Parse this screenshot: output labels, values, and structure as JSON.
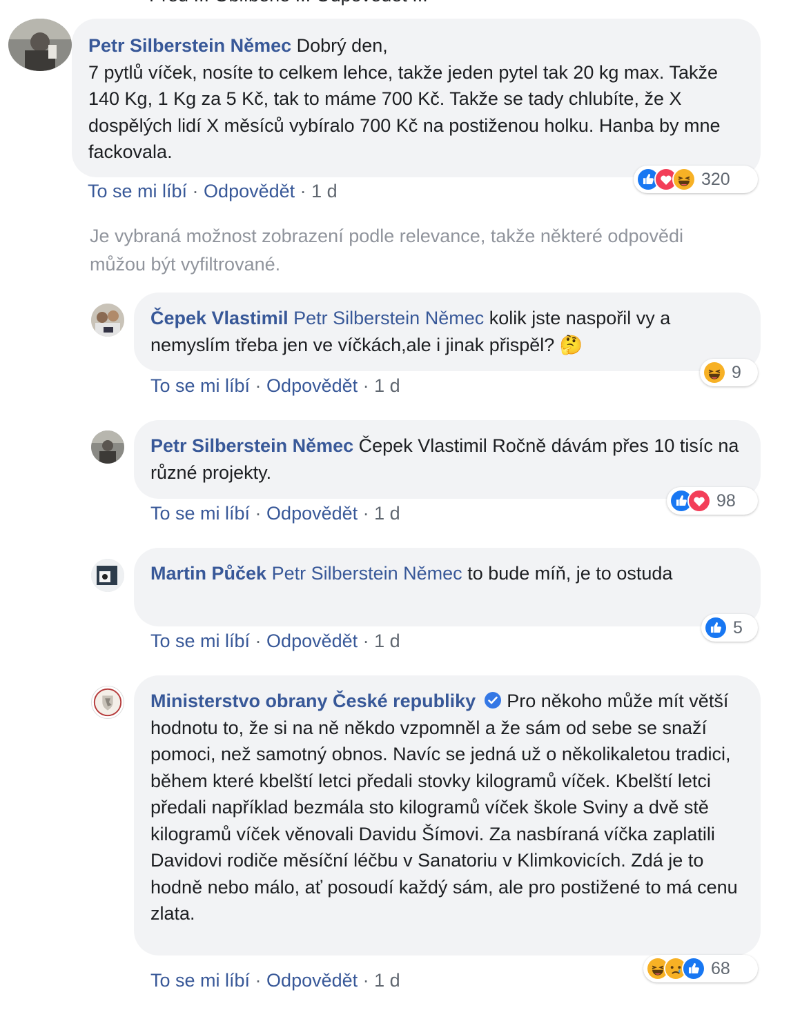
{
  "cut_off_text": "Před ... Oblíbené ... Odpovědět ...",
  "actions": {
    "like": "To se mi líbí",
    "reply": "Odpovědět",
    "sep": " · "
  },
  "notice": "Je vybraná možnost zobrazení podle relevance, takže některé odpovědi můžou být vyfiltrované.",
  "comments": [
    {
      "author": "Petr Silberstein Němec",
      "mention": "",
      "text": "Dobrý den,\n7 pytlů víček, nosíte to celkem lehce, takže jeden pytel tak 20 kg max. Takže 140 Kg, 1 Kg za 5 Kč, tak to máme 700 Kč. Takže se tady chlubíte, že X dospělých lidí X měsíců vybíralo 700 Kč na postiženou holku. Hanba by mne fackovala.",
      "time": "1 d",
      "reactions": [
        "like-icon",
        "love-icon",
        "haha-icon"
      ],
      "reaction_count": "320"
    },
    {
      "author": "Čepek Vlastimil",
      "mention": "Petr Silberstein Němec",
      "text": " kolik jste naspořil vy a nemyslím třeba jen ve víčkách,ale i jinak přispěl? 🤔",
      "time": "1 d",
      "reactions": [
        "haha-icon"
      ],
      "reaction_count": "9"
    },
    {
      "author": "Petr Silberstein Němec",
      "mention": "",
      "text": "Čepek Vlastimil Ročně dávám přes 10 tisíc na různé projekty.",
      "time": "1 d",
      "reactions": [
        "like-icon",
        "love-icon"
      ],
      "reaction_count": "98"
    },
    {
      "author": "Martin Půček",
      "mention": "Petr Silberstein Němec",
      "text": " to bude míň, je to ostuda",
      "time": "1 d",
      "reactions": [
        "like-icon"
      ],
      "reaction_count": "5"
    },
    {
      "author": "Ministerstvo obrany České republiky",
      "mention": "",
      "text": "Pro někoho může mít větší hodnotu to, že si na ně někdo vzpomněl a že sám od sebe se snaží pomoci, než samotný obnos. Navíc se jedná už o několikaletou tradici, během které kbelští letci předali stovky kilogramů víček. Kbelští letci předali například bezmála sto kilogramů víček škole Sviny a dvě stě kilogramů víček věnovali Davidu Šímovi. Za nasbíraná víčka zaplatili Davidovi rodiče měsíční léčbu v Sanatoriu v Klimkovicích. Zdá je to hodně nebo málo, ať posoudí každý sám, ale pro postižené to má cenu zlata.",
      "time": "1 d",
      "reactions": [
        "haha-icon",
        "sad-icon",
        "like-icon"
      ],
      "reaction_count": "68"
    }
  ],
  "colors": {
    "link": "#385898",
    "bubble": "#f2f3f5",
    "meta": "#606770",
    "notice": "#90949c",
    "like": "#1877f2",
    "love": "#f33e58",
    "haha": "#f7b125"
  }
}
